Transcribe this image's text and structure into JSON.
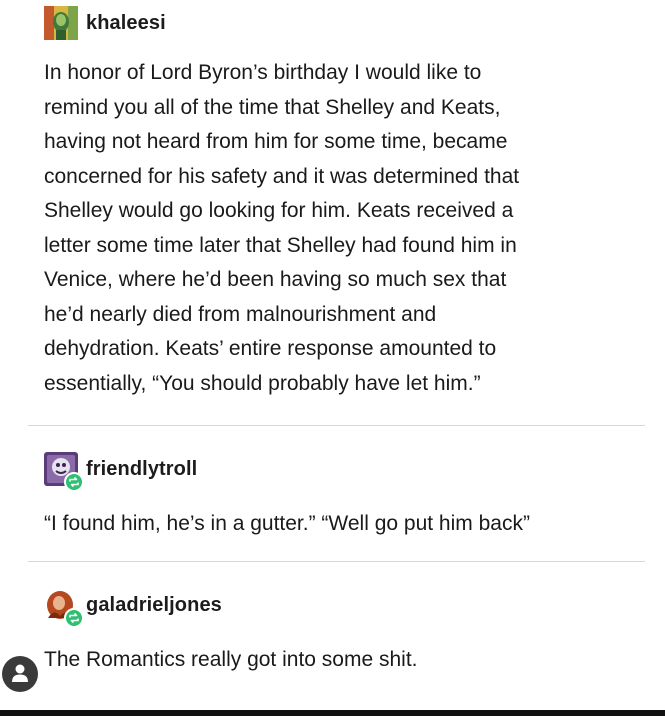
{
  "posts": [
    {
      "username": "khaleesi",
      "avatar_icon": "khaleesi-avatar-icon",
      "text": "In honor of Lord Byron’s birthday I would like to\nremind you all of the time that Shelley and Keats,\nhaving not heard from him for some time, became\nconcerned for his safety and it was determined that\nShelley would go looking for him. Keats received a\nletter some time later that Shelley had found him in\nVenice, where he’d been having so much sex that\nhe’d nearly died from malnourishment and\ndehydration. Keats’ entire response amounted to\nessentially, “You should probably have let him.”"
    },
    {
      "username": "friendlytroll",
      "avatar_icon": "friendlytroll-avatar-icon",
      "reblog_icon": "reblog-icon",
      "text": "“I found him, he’s in a gutter.” “Well go put him back”"
    },
    {
      "username": "galadrieljones",
      "avatar_icon": "galadrieljones-avatar-icon",
      "reblog_icon": "reblog-icon",
      "text": "The Romantics really got into some shit."
    }
  ],
  "colors": {
    "reblog_badge": "#2fbf71",
    "divider": "#d8d8d8",
    "text": "#1a1a1a"
  }
}
